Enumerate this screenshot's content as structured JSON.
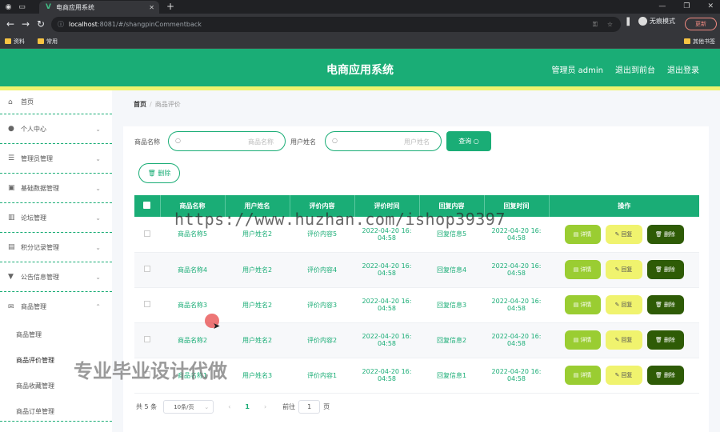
{
  "browser": {
    "tab_title": "电商应用系统",
    "url_host": "localhost",
    "url_rest": ":8081/#/shangpinCommentback",
    "incognito": "无痕模式",
    "update": "更新",
    "bookmarks": [
      "资料",
      "常用"
    ],
    "bookmarks_right": "其他书签"
  },
  "header": {
    "title": "电商应用系统",
    "admin": "管理员 admin",
    "to_front": "退出到前台",
    "logout": "退出登录"
  },
  "sidebar": {
    "items": [
      {
        "label": "首页",
        "icon": "home-icon"
      },
      {
        "label": "个人中心",
        "icon": "user-icon"
      },
      {
        "label": "管理员管理",
        "icon": "sliders-icon"
      },
      {
        "label": "基础数据管理",
        "icon": "image-icon"
      },
      {
        "label": "论坛管理",
        "icon": "chart-icon"
      },
      {
        "label": "积分记录管理",
        "icon": "clipboard-icon"
      },
      {
        "label": "公告信息管理",
        "icon": "pin-icon"
      },
      {
        "label": "商品管理",
        "icon": "mail-icon"
      }
    ],
    "subitems": [
      "商品管理",
      "商品评价管理",
      "商品收藏管理",
      "商品订单管理"
    ]
  },
  "breadcrumb": {
    "home": "首页",
    "sep": "/",
    "current": "商品评价"
  },
  "search": {
    "label1": "商品名称",
    "placeholder1": "商品名称",
    "label2": "用户姓名",
    "placeholder2": "用户姓名",
    "query": "查询",
    "delete": "删除"
  },
  "table": {
    "headers": [
      "商品名称",
      "用户姓名",
      "评价内容",
      "评价时间",
      "回复内容",
      "回复时间",
      "操作"
    ],
    "rows": [
      {
        "name": "商品名称5",
        "user": "用户姓名2",
        "content": "评价内容5",
        "time1": "2022-04-20 16:",
        "time2": "04:58",
        "reply": "回复信息5",
        "rtime1": "2022-04-20 16:",
        "rtime2": "04:58"
      },
      {
        "name": "商品名称4",
        "user": "用户姓名2",
        "content": "评价内容4",
        "time1": "2022-04-20 16:",
        "time2": "04:58",
        "reply": "回复信息4",
        "rtime1": "2022-04-20 16:",
        "rtime2": "04:58"
      },
      {
        "name": "商品名称3",
        "user": "用户姓名2",
        "content": "评价内容3",
        "time1": "2022-04-20 16:",
        "time2": "04:58",
        "reply": "回复信息3",
        "rtime1": "2022-04-20 16:",
        "rtime2": "04:58"
      },
      {
        "name": "商品名称2",
        "user": "用户姓名2",
        "content": "评价内容2",
        "time1": "2022-04-20 16:",
        "time2": "04:58",
        "reply": "回复信息2",
        "rtime1": "2022-04-20 16:",
        "rtime2": "04:58"
      },
      {
        "name": "商品名称1",
        "user": "用户姓名3",
        "content": "评价内容1",
        "time1": "2022-04-20 16:",
        "time2": "04:58",
        "reply": "回复信息1",
        "rtime1": "2022-04-20 16:",
        "rtime2": "04:58"
      }
    ],
    "ops": {
      "detail": "详情",
      "reply": "回复",
      "delete": "删除"
    }
  },
  "pager": {
    "total": "共 5 条",
    "size": "10条/页",
    "page": "1",
    "goto": "前往",
    "goto_val": "1",
    "page_unit": "页"
  },
  "watermark": {
    "url": "https://www.huzhan.com/ishop39397",
    "text": "专业毕业设计代做"
  }
}
